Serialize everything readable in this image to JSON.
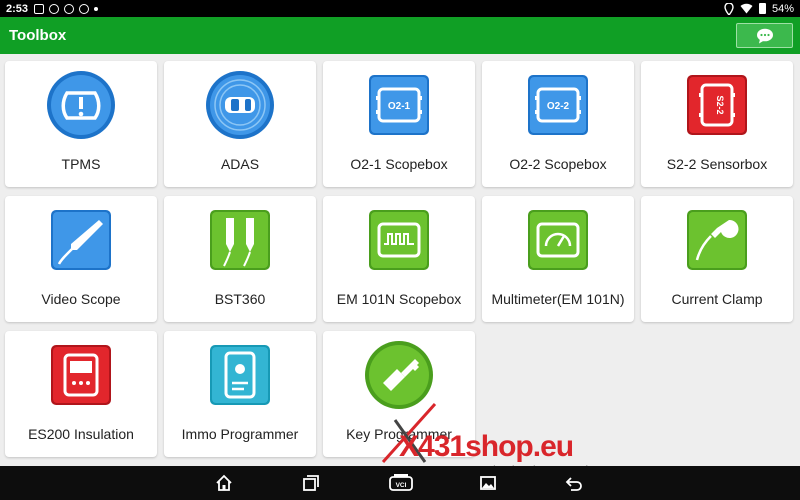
{
  "status_bar": {
    "time": "2:53",
    "battery": "54%",
    "icons": [
      "image-icon",
      "steering-icon",
      "chat-icon",
      "chat-icon",
      "dot-icon"
    ],
    "right_icons": [
      "location-icon",
      "wifi-icon",
      "battery-icon"
    ]
  },
  "header": {
    "title": "Toolbox",
    "action_icon": "message-bubble-icon",
    "bg_color": "#109f25"
  },
  "tools": [
    {
      "label": "TPMS",
      "icon": "tpms-icon"
    },
    {
      "label": "ADAS",
      "icon": "adas-icon"
    },
    {
      "label": "O2-1 Scopebox",
      "icon": "scopebox-icon",
      "icon_text": "O2-1"
    },
    {
      "label": "O2-2 Scopebox",
      "icon": "scopebox-icon",
      "icon_text": "O2-2"
    },
    {
      "label": "S2-2 Sensorbox",
      "icon": "sensorbox-icon",
      "icon_text": "S2-2"
    },
    {
      "label": "Video Scope",
      "icon": "video-scope-icon"
    },
    {
      "label": "BST360",
      "icon": "bst360-icon"
    },
    {
      "label": "EM 101N Scopebox",
      "icon": "oscilloscope-icon"
    },
    {
      "label": "Multimeter(EM 101N)",
      "icon": "multimeter-icon"
    },
    {
      "label": "Current Clamp",
      "icon": "current-clamp-icon"
    },
    {
      "label": "ES200 Insulation",
      "icon": "insulation-tester-icon"
    },
    {
      "label": "Immo Programmer",
      "icon": "immo-programmer-icon"
    },
    {
      "label": "Key Programmer",
      "icon": "key-programmer-icon"
    }
  ],
  "watermark": {
    "brand_x": "X",
    "brand_rest": "431shop.eu",
    "tagline": "LAUNCH Authorized EU Dealer"
  },
  "nav_bar": {
    "buttons": [
      "home-icon",
      "recent-apps-icon",
      "vci-icon",
      "screenshot-icon",
      "back-icon"
    ],
    "vci_text": "VCI"
  }
}
